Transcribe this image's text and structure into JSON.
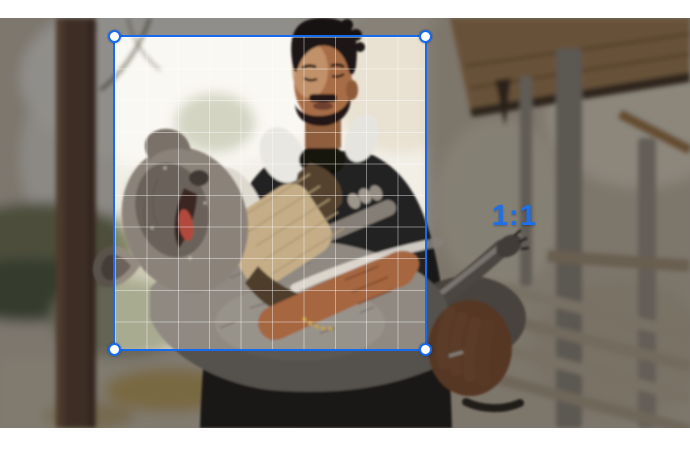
{
  "editor": {
    "ratio_label": "1:1",
    "accent_color": "#156af0",
    "overlay_color": "rgba(15,13,12,0.45)",
    "grid_line_color": "rgba(255,255,255,0.42)",
    "photo_alt": "Man in dark hoodie holding a gray French bulldog in front of a wooden pavilion"
  }
}
